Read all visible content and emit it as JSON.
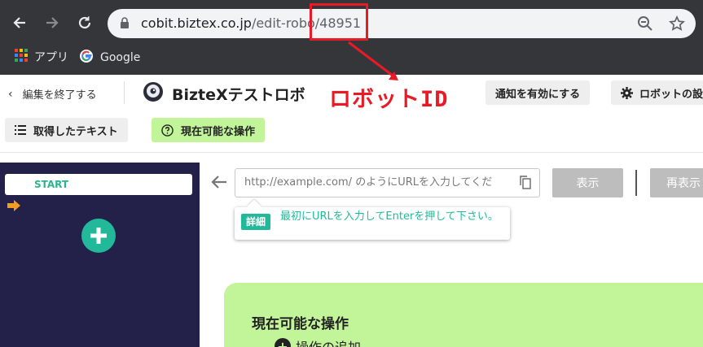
{
  "browser": {
    "url_host": "cobit.biztex.co.jp",
    "url_path": "/edit-robo",
    "url_id": "/48951",
    "bookmarks": [
      {
        "label": "アプリ",
        "icon": "apps-grid-icon"
      },
      {
        "label": "Google",
        "icon": "google-icon"
      }
    ]
  },
  "annotation": {
    "label": "ロボットID",
    "color": "#e81a25"
  },
  "header": {
    "exit_label": "編集を終了する",
    "robot_name": "BizteXテストロボ",
    "notify_button": "通知を有効にする",
    "robot_settings_button": "ロボットの設",
    "acquired_text_button": "取得したテキスト",
    "current_ops_button": "現在可能な操作"
  },
  "flow": {
    "start_label": "START"
  },
  "browser_panel": {
    "url_placeholder": "http://example.com/ のようにURLを入力してくだ",
    "show_button": "表示",
    "reshow_button": "再表示",
    "tooltip_badge": "詳細",
    "tooltip_text": "最初にURLを入力してEnterを押して下さい。"
  },
  "card": {
    "title": "現在可能な操作",
    "subtitle": "操作の追加"
  },
  "colors": {
    "accent_green": "#22b99a",
    "light_green": "#c2f59a",
    "dark_panel": "#23204a",
    "chrome_dark": "#35363a"
  }
}
